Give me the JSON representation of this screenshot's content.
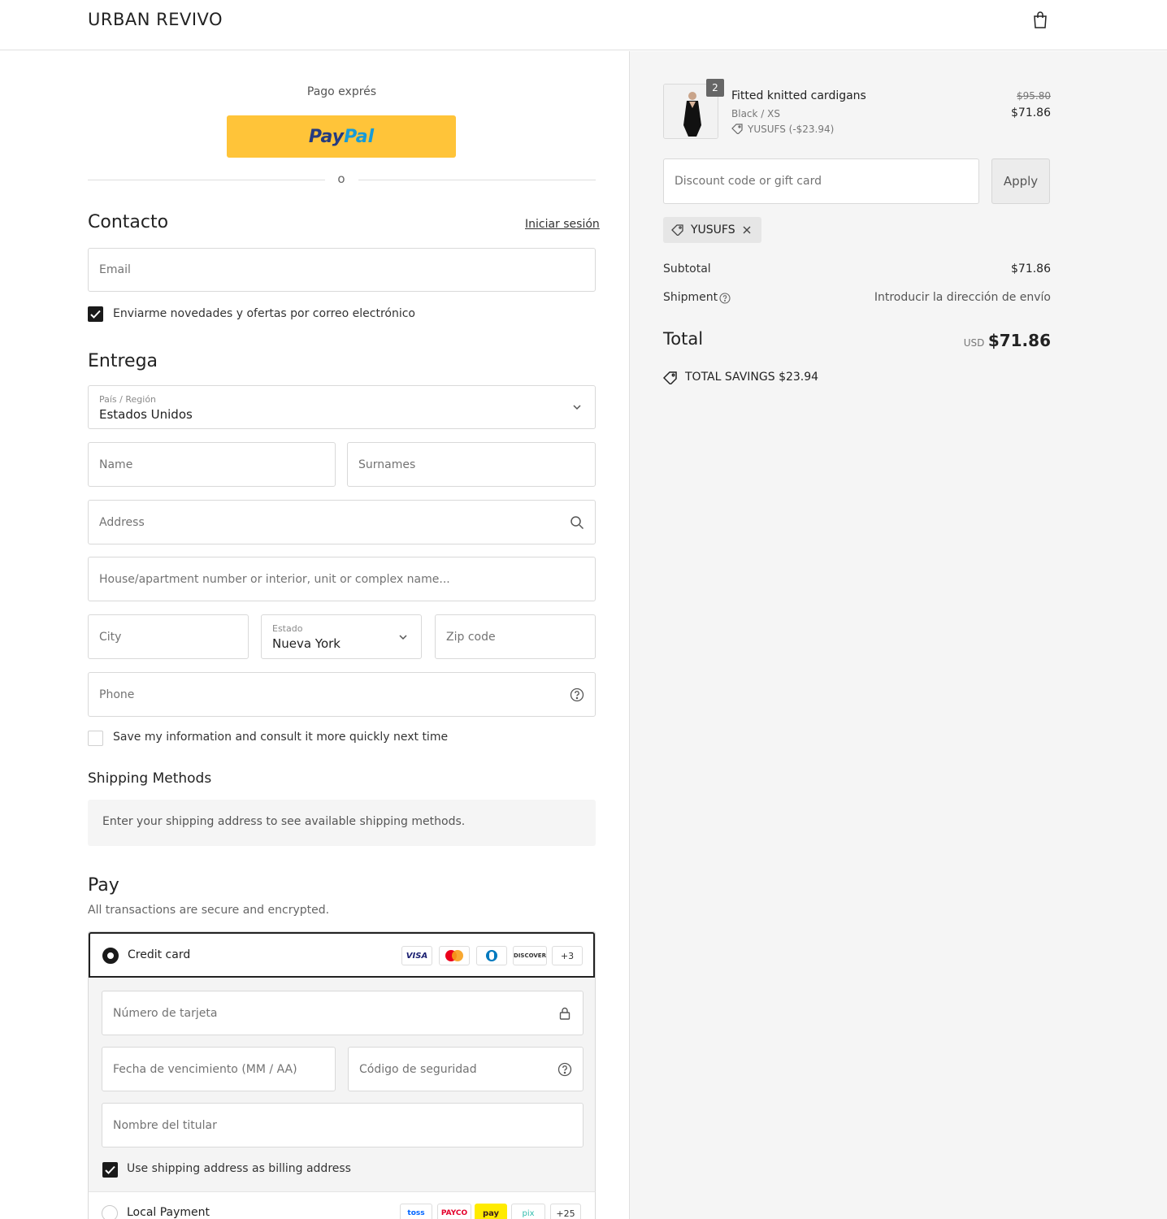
{
  "header": {
    "logo": "URBAN REVIVO",
    "cart_icon": "shopping-bag-icon"
  },
  "express": {
    "label": "Pago exprés",
    "paypal_part1": "Pay",
    "paypal_part2": "Pal",
    "divider": "o"
  },
  "contact": {
    "title": "Contacto",
    "login_link": "Iniciar sesión",
    "email_placeholder": "Email",
    "newsletter_label": "Enviarme novedades y ofertas por correo electrónico",
    "newsletter_checked": true
  },
  "delivery": {
    "title": "Entrega",
    "country_label": "País / Región",
    "country_value": "Estados Unidos",
    "name_placeholder": "Name",
    "surnames_placeholder": "Surnames",
    "address_placeholder": "Address",
    "apartment_placeholder": "House/apartment number or interior, unit or complex name...",
    "city_placeholder": "City",
    "state_label": "Estado",
    "state_value": "Nueva York",
    "zip_placeholder": "Zip code",
    "phone_placeholder": "Phone",
    "save_info_label": "Save my information and consult it more quickly next time",
    "save_info_checked": false
  },
  "shipping_methods": {
    "title": "Shipping Methods",
    "info": "Enter your shipping address to see available shipping methods."
  },
  "pay": {
    "title": "Pay",
    "subtitle": "All transactions are secure and encrypted.",
    "credit_card_label": "Credit card",
    "card_logos": [
      "VISA",
      "mastercard",
      "diners",
      "DISCOVER",
      "+3"
    ],
    "card_number_placeholder": "Número de tarjeta",
    "expiry_placeholder": "Fecha de vencimiento (MM / AA)",
    "cvv_placeholder": "Código de seguridad",
    "holder_placeholder": "Nombre del titular",
    "billing_same_label": "Use shipping address as billing address",
    "billing_same_checked": true,
    "local_payment_label": "Local Payment",
    "local_logos": [
      "toss",
      "PAYCO",
      "pay",
      "pix",
      "+25"
    ]
  },
  "summary": {
    "item": {
      "quantity": "2",
      "name": "Fitted knitted cardigans",
      "variant": "Black / XS",
      "discount": "YUSUFS (-$23.94)",
      "original_price": "$95.80",
      "price": "$71.86"
    },
    "discount_placeholder": "Discount code or gift card",
    "apply_label": "Apply",
    "applied_code": "YUSUFS",
    "subtotal_label": "Subtotal",
    "subtotal_value": "$71.86",
    "shipment_label": "Shipment",
    "shipment_value": "Introducir la dirección de envío",
    "total_label": "Total",
    "total_currency": "USD",
    "total_value": "$71.86",
    "savings_label": "TOTAL SAVINGS",
    "savings_value": "$23.94"
  },
  "colors": {
    "paypal_yellow": "#ffc439",
    "sidebar_bg": "#f5f5f5",
    "accent": "#1a1a1a"
  }
}
